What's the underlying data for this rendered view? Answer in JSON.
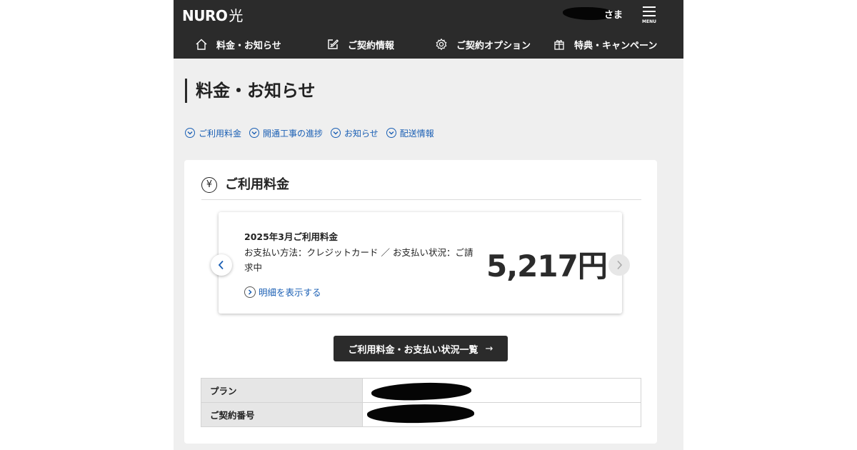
{
  "header": {
    "logo_text": "NURO",
    "logo_suffix": "光",
    "user_suffix": "さま",
    "menu_label": "MENU",
    "nav": [
      {
        "label": "料金・お知らせ",
        "icon": "home-icon"
      },
      {
        "label": "ご契約情報",
        "icon": "edit-icon"
      },
      {
        "label": "ご契約オプション",
        "icon": "gear-icon"
      },
      {
        "label": "特典・キャンペーン",
        "icon": "gift-icon"
      }
    ]
  },
  "page": {
    "title": "料金・お知らせ",
    "anchors": [
      "ご利用料金",
      "開通工事の進捗",
      "お知らせ",
      "配送情報"
    ]
  },
  "billing": {
    "section_icon": "yen-icon",
    "yen_symbol": "¥",
    "section_title": "ご利用料金",
    "month_label": "2025年3月ご利用料金",
    "status_text": "お支払い方法：クレジットカード ／ お支払い状況：ご請求中",
    "amount": "5,217円",
    "detail_link": "明細を表示する",
    "list_button": "ご利用料金・お支払い状況一覧",
    "list_button_arrow": "→"
  },
  "contract_table": [
    {
      "label": "プラン"
    },
    {
      "label": "ご契約番号"
    }
  ],
  "colors": {
    "header_bg": "#2b2b2b",
    "link": "#1a5fb4",
    "page_bg": "#efefef"
  }
}
